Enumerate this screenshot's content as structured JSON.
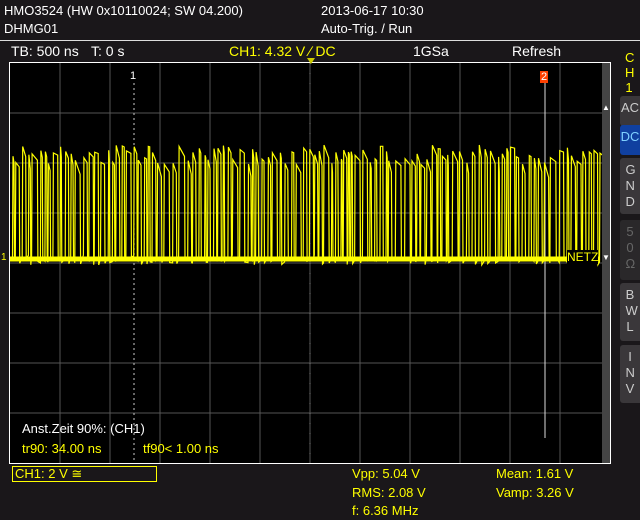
{
  "header": {
    "device": "HMO3524 (HW 0x10110024; SW 04.200)",
    "name": "DHMG01",
    "datetime": "2013-06-17 10:30",
    "trigger_mode": "Auto-Trig. / Run"
  },
  "status": {
    "timebase": "TB: 500 ns",
    "time": "T: 0 s",
    "trigger": "CH1: 4.32 V ∕ DC",
    "sample_rate": "1GSa",
    "mode": "Refresh"
  },
  "side": {
    "channel": "CH1",
    "buttons": [
      "AC",
      "DC",
      "GND",
      "50Ω",
      "BWL",
      "INV"
    ],
    "active": "DC"
  },
  "markers": {
    "cursor1": "1",
    "cursor2": "2",
    "channel_marker": "1",
    "netz": "NETZ"
  },
  "measure": {
    "title": "Anst.Zeit 90%: (CH1)",
    "tr90": "tr90: 34.00 ns",
    "tf90": "tf90< 1.00 ns"
  },
  "channel_box": "CH1: 2 V ≅",
  "results": {
    "vpp": "Vpp: 5.04 V",
    "rms": "RMS: 2.08 V",
    "f": "f: 6.36 MHz",
    "mean": "Mean: 1.61 V",
    "vamp": "Vamp: 3.26 V"
  },
  "colors": {
    "trace": "#ffff00",
    "active_button": "#1040a0",
    "cursor2": "#ff4000"
  }
}
